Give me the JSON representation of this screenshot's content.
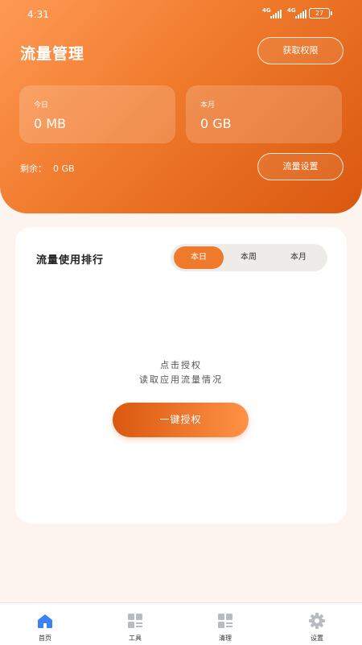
{
  "status": {
    "time": "4:31",
    "sig1": "4G",
    "sig2": "4G",
    "battery": "27"
  },
  "header": {
    "title": "流量管理",
    "auth_button": "获取权限",
    "today_label": "今日",
    "today_value": "0 MB",
    "month_label": "本月",
    "month_value": "0 GB",
    "remain_label": "剩余：",
    "remain_value": "0 GB",
    "setting_button": "流量设置"
  },
  "ranking": {
    "title": "流量使用排行",
    "tabs": [
      "本日",
      "本周",
      "本月"
    ],
    "selected_tab": "本日",
    "hint_line1": "点击授权",
    "hint_line2": "读取应用流量情况",
    "onekey_button": "一键授权"
  },
  "nav": {
    "items": [
      {
        "label": "首页",
        "icon": "home-icon"
      },
      {
        "label": "工具",
        "icon": "tools-icon"
      },
      {
        "label": "清理",
        "icon": "clean-icon"
      },
      {
        "label": "设置",
        "icon": "settings-gear-icon"
      }
    ]
  },
  "colors": {
    "accent": "#f07a2c",
    "accent_dark": "#d9580f",
    "nav_active": "#3b82f6",
    "nav_inactive": "#b8bcc2"
  }
}
